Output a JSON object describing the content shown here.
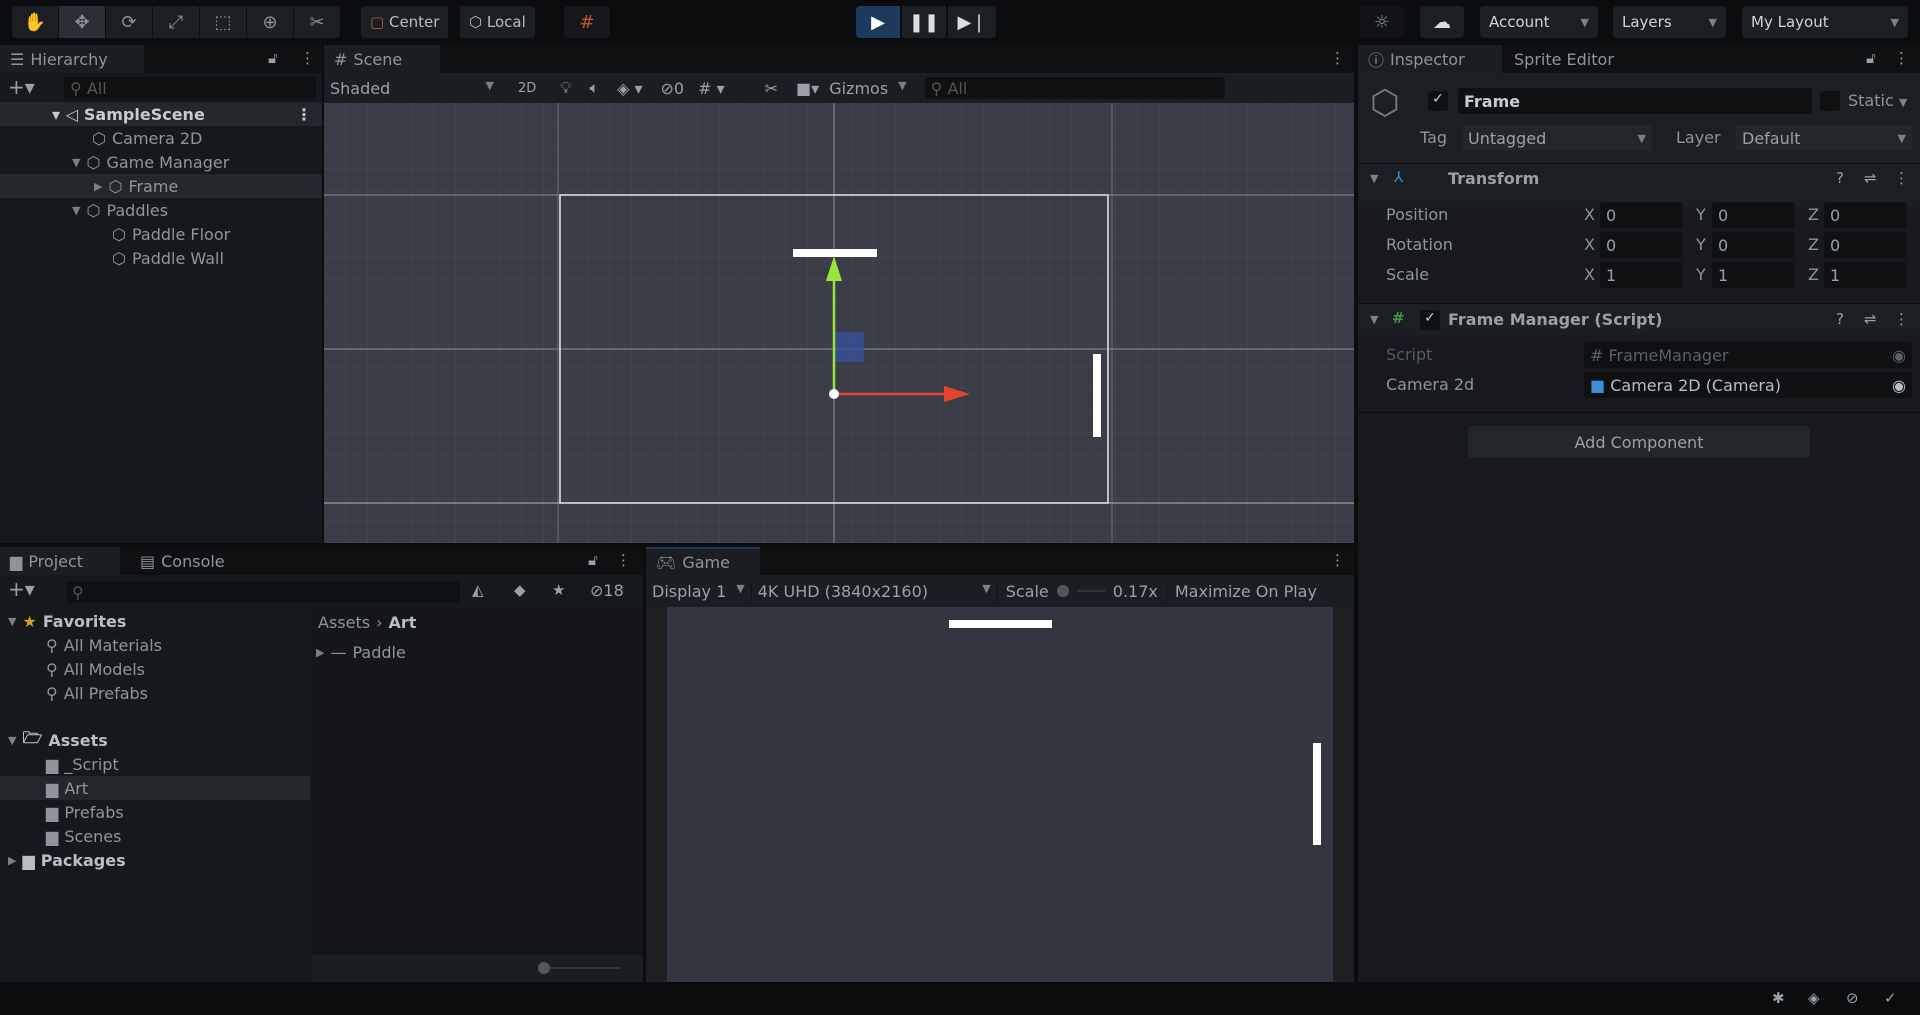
{
  "toolbar": {
    "tools": [
      "hand-tool",
      "move-tool",
      "rotate-tool",
      "scale-tool",
      "rect-tool",
      "transform-tool",
      "custom-tool"
    ],
    "pivot": "Center",
    "space": "Local",
    "account": "Account",
    "layers": "Layers",
    "layout": "My Layout"
  },
  "hierarchy": {
    "tab": "Hierarchy",
    "search_placeholder": "All",
    "scene": "SampleScene",
    "items": [
      {
        "label": "Camera 2D"
      },
      {
        "label": "Game Manager"
      },
      {
        "label": "Frame"
      },
      {
        "label": "Paddles"
      },
      {
        "label": "Paddle Floor"
      },
      {
        "label": "Paddle Wall"
      }
    ]
  },
  "scene": {
    "tab": "Scene",
    "shading": "Shaded",
    "mode_2d": "2D",
    "hidden_count": "0",
    "gizmos": "Gizmos",
    "search_placeholder": "All"
  },
  "inspector": {
    "tab": "Inspector",
    "tab2": "Sprite Editor",
    "object_name": "Frame",
    "active": true,
    "static_label": "Static",
    "tag_label": "Tag",
    "tag": "Untagged",
    "layer_label": "Layer",
    "layer": "Default",
    "transform": {
      "title": "Transform",
      "rows": [
        {
          "label": "Position",
          "x": "0",
          "y": "0",
          "z": "0"
        },
        {
          "label": "Rotation",
          "x": "0",
          "y": "0",
          "z": "0"
        },
        {
          "label": "Scale",
          "x": "1",
          "y": "1",
          "z": "1"
        }
      ]
    },
    "script": {
      "title": "Frame Manager (Script)",
      "script_label": "Script",
      "script_value": "FrameManager",
      "camera_label": "Camera 2d",
      "camera_value": "Camera 2D (Camera)"
    },
    "add_component": "Add Component"
  },
  "project": {
    "tab": "Project",
    "tab2": "Console",
    "hidden_count": "18",
    "favorites": "Favorites",
    "fav_items": [
      "All Materials",
      "All Models",
      "All Prefabs"
    ],
    "assets": "Assets",
    "asset_items": [
      "_Script",
      "Art",
      "Prefabs",
      "Scenes"
    ],
    "packages": "Packages",
    "breadcrumb": [
      "Assets",
      "Art"
    ],
    "files": [
      "Paddle"
    ]
  },
  "game": {
    "tab": "Game",
    "display": "Display 1",
    "resolution": "4K UHD (3840x2160)",
    "scale_label": "Scale",
    "scale_value": "0.17x",
    "maximize": "Maximize On Play"
  },
  "colors": {
    "accent": "#1d3a5c",
    "scene_bg": "#3a3d47",
    "game_bg": "#333640"
  }
}
